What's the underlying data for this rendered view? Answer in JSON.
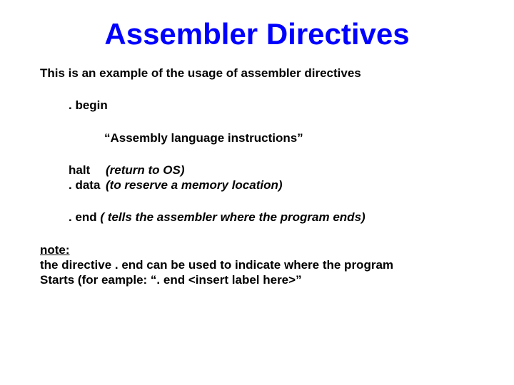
{
  "title": "Assembler Directives",
  "intro": "This is an example of the usage of assembler directives",
  "begin": ". begin",
  "asm_instr": "“Assembly language instructions”",
  "halt": {
    "label": "halt",
    "desc": "(return to OS)"
  },
  "data": {
    "label": ". data",
    "desc": "(to reserve a memory location)"
  },
  "end": {
    "label": ". end",
    "desc": "( tells the assembler where the program ends)"
  },
  "note": {
    "label": "note:",
    "line1": "the directive . end can be used to indicate where the  program",
    "line2": "Starts (for eample: “. end <insert label here>”"
  }
}
